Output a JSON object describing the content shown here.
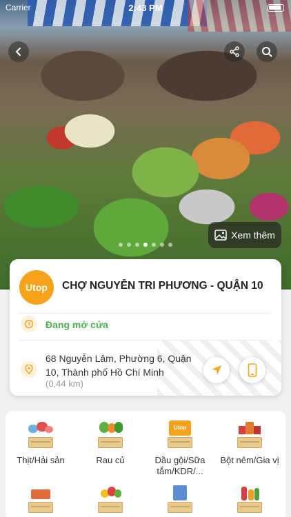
{
  "status_bar": {
    "carrier": "Carrier",
    "time": "2:43 PM"
  },
  "hero": {
    "more_label": "Xem thêm",
    "dots_count": 7,
    "active_dot": 3
  },
  "store": {
    "logo_text": "Utop",
    "name": "CHỢ NGUYỄN TRI PHƯƠNG - QUẬN 10",
    "open_status": "Đang mở cửa",
    "address": "68 Nguyễn Lâm, Phường 6, Quận 10, Thành phố Hồ Chí Minh",
    "distance": "(0,44 km)"
  },
  "colors": {
    "accent": "#f7a21b",
    "open_green": "#4caf50"
  },
  "categories": [
    {
      "label": "Thịt/Hải sản",
      "icon": "meat-seafood-icon"
    },
    {
      "label": "Rau củ",
      "icon": "vegetables-icon"
    },
    {
      "label": "Dầu gội/Sữa tắm/KDR/...",
      "icon": "personal-care-icon"
    },
    {
      "label": "Bột nêm/Gia vị",
      "icon": "spices-icon"
    },
    {
      "label": "",
      "icon": "snacks-icon"
    },
    {
      "label": "",
      "icon": "fruits-icon"
    },
    {
      "label": "",
      "icon": "milk-icon"
    },
    {
      "label": "",
      "icon": "beverages-icon"
    }
  ]
}
